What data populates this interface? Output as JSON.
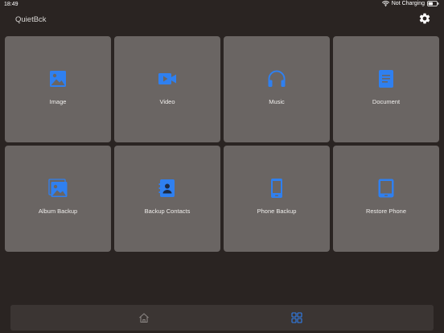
{
  "status_bar": {
    "time": "18:49",
    "charging_text": "Not Charging",
    "battery_level": 0.55
  },
  "header": {
    "app_title": "QuietBck",
    "settings_icon": "gear-icon"
  },
  "tiles": [
    {
      "label": "Image",
      "icon": "image-icon"
    },
    {
      "label": "Video",
      "icon": "video-camera-icon"
    },
    {
      "label": "Music",
      "icon": "headphones-icon"
    },
    {
      "label": "Document",
      "icon": "document-icon"
    },
    {
      "label": "Album Backup",
      "icon": "photo-album-icon"
    },
    {
      "label": "Backup Contacts",
      "icon": "contact-card-icon"
    },
    {
      "label": "Phone Backup",
      "icon": "phone-icon"
    },
    {
      "label": "Restore Phone",
      "icon": "tablet-icon"
    }
  ],
  "tab_bar": {
    "items": [
      {
        "icon": "home-icon",
        "selected": false
      },
      {
        "icon": "grid-icon",
        "selected": true
      }
    ]
  },
  "colors": {
    "background": "#2a2422",
    "tile": "#6a6563",
    "accent": "#2f80f0",
    "tab_bar": "#3b3533"
  }
}
